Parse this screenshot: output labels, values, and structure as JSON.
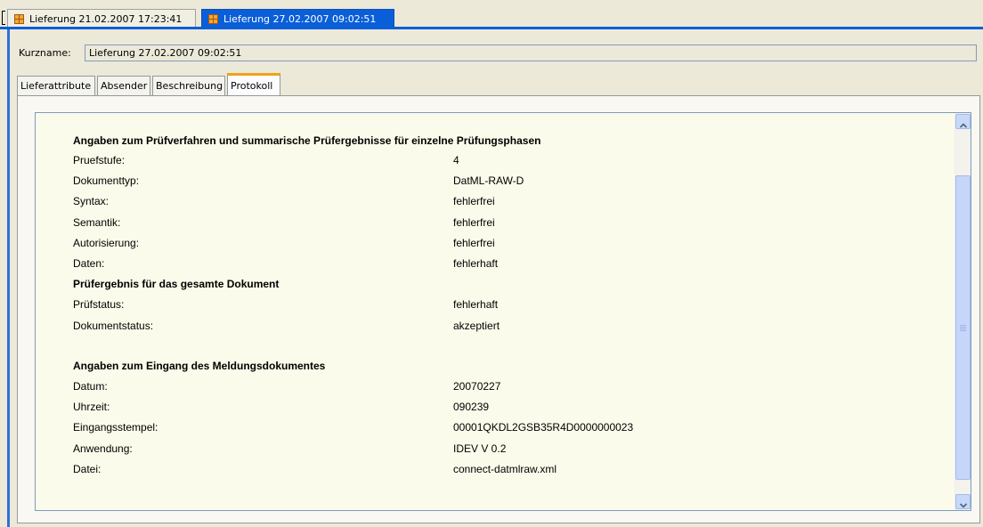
{
  "document_tabs": [
    {
      "label": "Lieferung 21.02.2007 17:23:41",
      "active": false
    },
    {
      "label": "Lieferung 27.02.2007 09:02:51",
      "active": true
    }
  ],
  "shortname": {
    "label": "Kurzname:",
    "value": "Lieferung 27.02.2007 09:02:51"
  },
  "subtabs": [
    "Lieferattribute",
    "Absender",
    "Beschreibung",
    "Protokoll"
  ],
  "protocol": {
    "section1_title": "Angaben zum Prüfverfahren und summarische Prüfergebnisse für einzelne Prüfungsphasen",
    "section1_rows": [
      {
        "label": "Pruefstufe:",
        "value": "4"
      },
      {
        "label": "Dokumenttyp:",
        "value": "DatML-RAW-D"
      },
      {
        "label": "Syntax:",
        "value": "fehlerfrei"
      },
      {
        "label": "Semantik:",
        "value": "fehlerfrei"
      },
      {
        "label": "Autorisierung:",
        "value": "fehlerfrei"
      },
      {
        "label": "Daten:",
        "value": "fehlerhaft"
      }
    ],
    "section2_title": "Prüfergebnis für das gesamte Dokument",
    "section2_rows": [
      {
        "label": "Prüfstatus:",
        "value": "fehlerhaft"
      },
      {
        "label": "Dokumentstatus:",
        "value": "akzeptiert"
      }
    ],
    "section3_title": "Angaben zum Eingang des Meldungsdokumentes",
    "section3_rows": [
      {
        "label": "Datum:",
        "value": "20070227"
      },
      {
        "label": "Uhrzeit:",
        "value": "090239"
      },
      {
        "label": "Eingangsstempel:",
        "value": "00001QKDL2GSB35R4D0000000023"
      },
      {
        "label": "Anwendung:",
        "value": "IDEV V 0.2"
      },
      {
        "label": "Datei:",
        "value": "connect-datmlraw.xml"
      }
    ]
  },
  "colors": {
    "active_tab": "#0a5fd8",
    "protocol_bg": "#fbfbeb",
    "tab_highlight": "#f0a21a"
  },
  "icons": {
    "tab_icon": "grid-document-icon",
    "scroll_up": "chevron-up-icon",
    "scroll_down": "chevron-down-icon"
  }
}
